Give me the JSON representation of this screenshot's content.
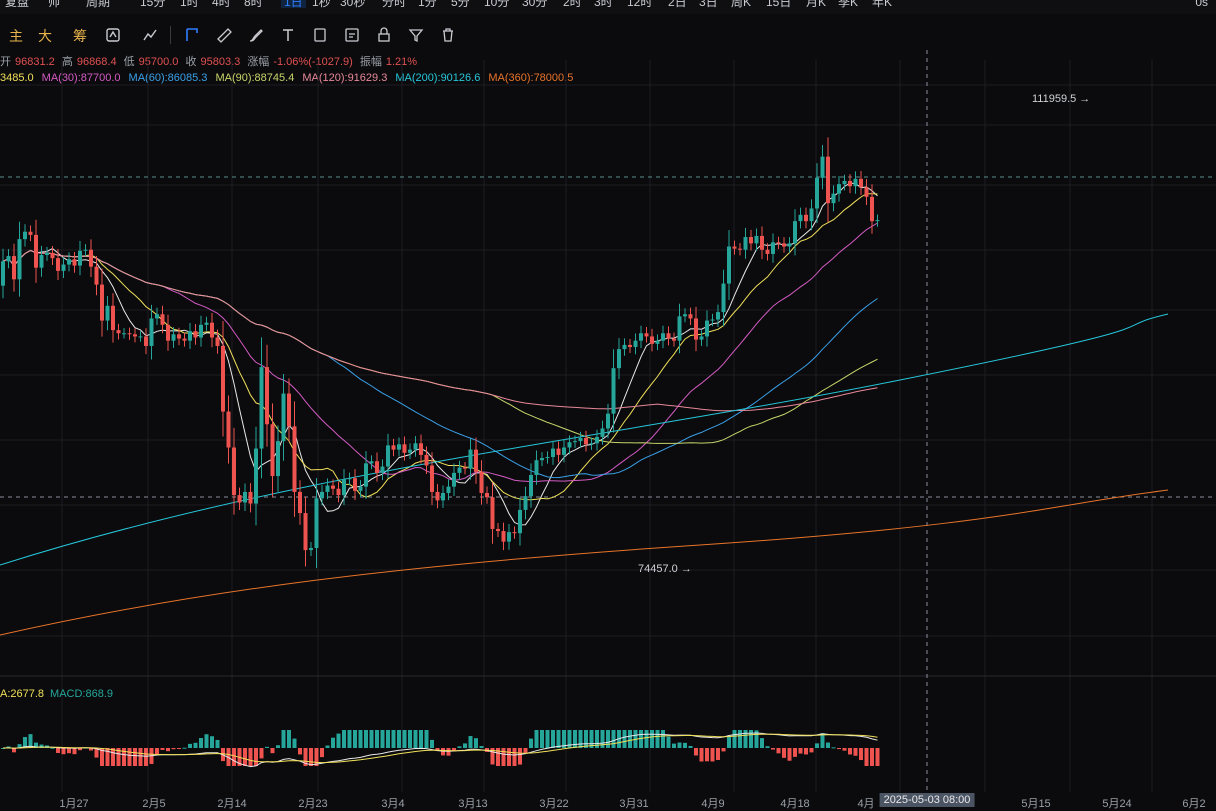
{
  "toolbar": {
    "items": [
      "复盘",
      "帅",
      "周期",
      "15分",
      "1时",
      "4时",
      "8时",
      "1日",
      "1秒",
      "30秒",
      "分时",
      "1分",
      "5分",
      "10分",
      "30分",
      "2时",
      "3时",
      "12时",
      "2日",
      "3日",
      "周K",
      "15日",
      "月K",
      "季K",
      "年K"
    ],
    "active_index": 7,
    "right_text": "0s"
  },
  "indicators": [
    "主",
    "大",
    "筹"
  ],
  "ohlc": {
    "open_label": "开",
    "open": "96831.2",
    "high_label": "高",
    "high": "96868.4",
    "low_label": "低",
    "low": "95700.0",
    "close_label": "收",
    "close": "95803.3",
    "change_label": "涨幅",
    "change": "-1.06%(-1027.9)",
    "amp_label": "振幅",
    "amp": "1.21%"
  },
  "ma_legend": [
    {
      "text": "3485.0",
      "color": "#f0e05a"
    },
    {
      "text": "MA(30):87700.0",
      "color": "#d45bc4"
    },
    {
      "text": "MA(60):86085.3",
      "color": "#3aa0e8"
    },
    {
      "text": "MA(90):88745.4",
      "color": "#c8d66a"
    },
    {
      "text": "MA(120):91629.3",
      "color": "#e8889a"
    },
    {
      "text": "MA(200):90126.6",
      "color": "#26c6da"
    },
    {
      "text": "MA(360):78000.5",
      "color": "#e8742a"
    }
  ],
  "price_labels": {
    "high": "111959.5 →",
    "low": "74457.0 →"
  },
  "macd_legend": [
    {
      "text": "A:2677.8",
      "color": "#f0e05a"
    },
    {
      "text": "MACD:868.9",
      "color": "#26a69a"
    }
  ],
  "xaxis": {
    "ticks": [
      "1月27",
      "2月5",
      "2月14",
      "2月23",
      "3月4",
      "3月13",
      "3月22",
      "3月31",
      "4月9",
      "4月18",
      "4月",
      "5月15",
      "5月24",
      "6月2"
    ],
    "crosshair_label": "2025-05-03 08:00"
  },
  "colors": {
    "up": "#26a69a",
    "down": "#ef5350",
    "grid": "#1c1c22"
  },
  "chart_data": {
    "type": "candlestick",
    "price_range": [
      66000,
      118000
    ],
    "bars": [
      {
        "o": 99500,
        "c": 101800
      },
      {
        "o": 101800,
        "c": 102300
      },
      {
        "o": 102300,
        "c": 100100
      },
      {
        "o": 100100,
        "c": 103900
      },
      {
        "o": 103900,
        "c": 104600
      },
      {
        "o": 104600,
        "c": 104300
      },
      {
        "o": 104300,
        "c": 101200
      },
      {
        "o": 101200,
        "c": 102400
      },
      {
        "o": 102400,
        "c": 102600
      },
      {
        "o": 102600,
        "c": 102100
      },
      {
        "o": 102100,
        "c": 100900
      },
      {
        "o": 100900,
        "c": 101500
      },
      {
        "o": 101500,
        "c": 102000
      },
      {
        "o": 102000,
        "c": 101400
      },
      {
        "o": 101400,
        "c": 102800
      },
      {
        "o": 102800,
        "c": 102900
      },
      {
        "o": 102900,
        "c": 101300
      },
      {
        "o": 101300,
        "c": 99600
      },
      {
        "o": 99600,
        "c": 96200
      },
      {
        "o": 96200,
        "c": 97600
      },
      {
        "o": 97600,
        "c": 95300
      },
      {
        "o": 95300,
        "c": 95000
      },
      {
        "o": 95000,
        "c": 95000
      },
      {
        "o": 95000,
        "c": 94900
      },
      {
        "o": 94900,
        "c": 94700
      },
      {
        "o": 94700,
        "c": 94700
      },
      {
        "o": 94700,
        "c": 93800
      },
      {
        "o": 93800,
        "c": 96400
      },
      {
        "o": 96400,
        "c": 96800
      },
      {
        "o": 96800,
        "c": 95800
      },
      {
        "o": 95800,
        "c": 94300
      },
      {
        "o": 94300,
        "c": 94900
      },
      {
        "o": 94900,
        "c": 94500
      },
      {
        "o": 94500,
        "c": 94300
      },
      {
        "o": 94300,
        "c": 95200
      },
      {
        "o": 95200,
        "c": 94600
      },
      {
        "o": 94600,
        "c": 95800
      },
      {
        "o": 95800,
        "c": 96000
      },
      {
        "o": 96000,
        "c": 94600
      },
      {
        "o": 94600,
        "c": 93800
      },
      {
        "o": 93800,
        "c": 87600
      },
      {
        "o": 87600,
        "c": 84200
      },
      {
        "o": 84200,
        "c": 79700
      },
      {
        "o": 79700,
        "c": 79000
      },
      {
        "o": 79000,
        "c": 80000
      },
      {
        "o": 80000,
        "c": 78900
      },
      {
        "o": 78900,
        "c": 84100
      },
      {
        "o": 84100,
        "c": 91800
      },
      {
        "o": 91800,
        "c": 86400
      },
      {
        "o": 86400,
        "c": 81500
      },
      {
        "o": 81500,
        "c": 84800
      },
      {
        "o": 84800,
        "c": 89300
      },
      {
        "o": 89300,
        "c": 86200
      },
      {
        "o": 86200,
        "c": 80000
      },
      {
        "o": 80000,
        "c": 78000
      },
      {
        "o": 78000,
        "c": 74500
      },
      {
        "o": 74500,
        "c": 74700
      },
      {
        "o": 74700,
        "c": 79400
      },
      {
        "o": 79400,
        "c": 80000
      },
      {
        "o": 80000,
        "c": 80600
      },
      {
        "o": 80600,
        "c": 80300
      },
      {
        "o": 80300,
        "c": 79700
      },
      {
        "o": 79700,
        "c": 81200
      },
      {
        "o": 81200,
        "c": 81300
      },
      {
        "o": 81300,
        "c": 80100
      },
      {
        "o": 80100,
        "c": 80500
      },
      {
        "o": 80500,
        "c": 82700
      },
      {
        "o": 82700,
        "c": 82900
      },
      {
        "o": 82900,
        "c": 81800
      },
      {
        "o": 81800,
        "c": 82400
      },
      {
        "o": 82400,
        "c": 84400
      },
      {
        "o": 84400,
        "c": 84000
      },
      {
        "o": 84000,
        "c": 84500
      },
      {
        "o": 84500,
        "c": 83700
      },
      {
        "o": 83700,
        "c": 84000
      },
      {
        "o": 84000,
        "c": 84600
      },
      {
        "o": 84600,
        "c": 83500
      },
      {
        "o": 83500,
        "c": 82500
      },
      {
        "o": 82500,
        "c": 80000
      },
      {
        "o": 80000,
        "c": 79200
      },
      {
        "o": 79200,
        "c": 79900
      },
      {
        "o": 79900,
        "c": 80500
      },
      {
        "o": 80500,
        "c": 81800
      },
      {
        "o": 81800,
        "c": 82300
      },
      {
        "o": 82300,
        "c": 82200
      },
      {
        "o": 82200,
        "c": 84000
      },
      {
        "o": 84000,
        "c": 81900
      },
      {
        "o": 81900,
        "c": 79900
      },
      {
        "o": 79900,
        "c": 79500
      },
      {
        "o": 79500,
        "c": 76500
      },
      {
        "o": 76500,
        "c": 76300
      },
      {
        "o": 76300,
        "c": 75300
      },
      {
        "o": 75300,
        "c": 76200
      },
      {
        "o": 76200,
        "c": 76100
      },
      {
        "o": 76100,
        "c": 78300
      },
      {
        "o": 78300,
        "c": 79600
      },
      {
        "o": 79600,
        "c": 81600
      },
      {
        "o": 81600,
        "c": 83000
      },
      {
        "o": 83000,
        "c": 83200
      },
      {
        "o": 83200,
        "c": 83300
      },
      {
        "o": 83300,
        "c": 84100
      },
      {
        "o": 84100,
        "c": 83500
      },
      {
        "o": 83500,
        "c": 84200
      },
      {
        "o": 84200,
        "c": 84700
      },
      {
        "o": 84700,
        "c": 84800
      },
      {
        "o": 84800,
        "c": 85100
      },
      {
        "o": 85100,
        "c": 84500
      },
      {
        "o": 84500,
        "c": 84600
      },
      {
        "o": 84600,
        "c": 85200
      },
      {
        "o": 85200,
        "c": 86000
      },
      {
        "o": 86000,
        "c": 87400
      },
      {
        "o": 87400,
        "c": 91700
      },
      {
        "o": 91700,
        "c": 93500
      },
      {
        "o": 93500,
        "c": 93900
      },
      {
        "o": 93900,
        "c": 93700
      },
      {
        "o": 93700,
        "c": 94300
      },
      {
        "o": 94300,
        "c": 95000
      },
      {
        "o": 95000,
        "c": 94700
      },
      {
        "o": 94700,
        "c": 94000
      },
      {
        "o": 94000,
        "c": 94300
      },
      {
        "o": 94300,
        "c": 95000
      },
      {
        "o": 95000,
        "c": 94500
      },
      {
        "o": 94500,
        "c": 94300
      },
      {
        "o": 94300,
        "c": 96600
      },
      {
        "o": 96600,
        "c": 96800
      },
      {
        "o": 96800,
        "c": 96400
      },
      {
        "o": 96400,
        "c": 94400
      },
      {
        "o": 94400,
        "c": 94700
      },
      {
        "o": 94700,
        "c": 96200
      },
      {
        "o": 96200,
        "c": 96300
      },
      {
        "o": 96300,
        "c": 97000
      },
      {
        "o": 97000,
        "c": 99700
      },
      {
        "o": 99700,
        "c": 103200
      },
      {
        "o": 103200,
        "c": 103000
      },
      {
        "o": 103000,
        "c": 102900
      },
      {
        "o": 102900,
        "c": 104100
      },
      {
        "o": 104100,
        "c": 103500
      },
      {
        "o": 103500,
        "c": 104200
      },
      {
        "o": 104200,
        "c": 102900
      },
      {
        "o": 102900,
        "c": 102500
      },
      {
        "o": 102500,
        "c": 103600
      },
      {
        "o": 103600,
        "c": 103500
      },
      {
        "o": 103500,
        "c": 103200
      },
      {
        "o": 103200,
        "c": 103500
      },
      {
        "o": 103500,
        "c": 105600
      },
      {
        "o": 105600,
        "c": 106200
      },
      {
        "o": 106200,
        "c": 105600
      },
      {
        "o": 105600,
        "c": 106800
      },
      {
        "o": 106800,
        "c": 109700
      },
      {
        "o": 109700,
        "c": 111700
      },
      {
        "o": 111700,
        "c": 107300
      },
      {
        "o": 107300,
        "c": 108200
      },
      {
        "o": 108200,
        "c": 109100
      },
      {
        "o": 109100,
        "c": 109400
      },
      {
        "o": 109400,
        "c": 108900
      },
      {
        "o": 108900,
        "c": 109600
      },
      {
        "o": 109600,
        "c": 108800
      },
      {
        "o": 108800,
        "c": 107900
      },
      {
        "o": 107900,
        "c": 105600
      },
      {
        "o": 105600,
        "c": 105700
      }
    ],
    "high": 111959.5,
    "low": 74457.0
  }
}
